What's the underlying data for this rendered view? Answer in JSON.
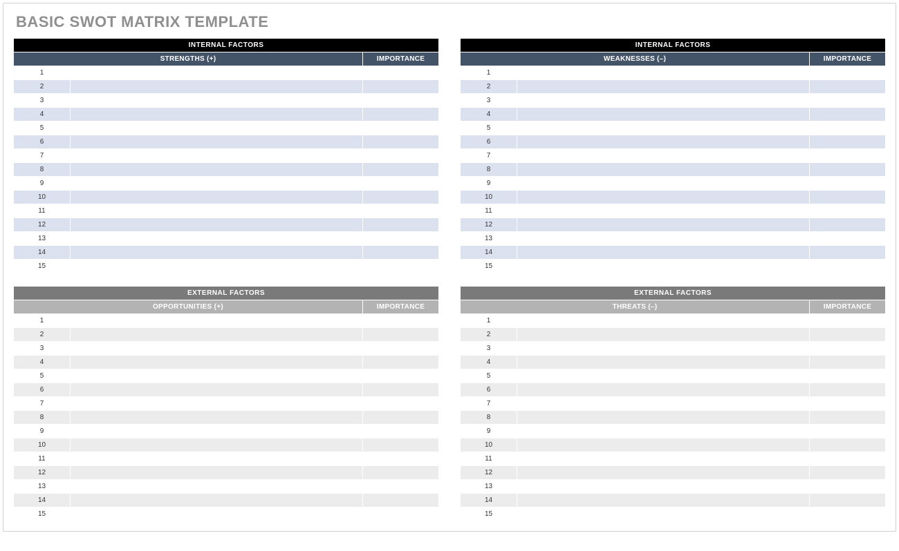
{
  "title": "BASIC SWOT MATRIX TEMPLATE",
  "row_count": 15,
  "importance_label": "IMPORTANCE",
  "quadrants": [
    {
      "id": "strengths",
      "section": "INTERNAL FACTORS",
      "header": "STRENGTHS (+)",
      "theme": "internal"
    },
    {
      "id": "weaknesses",
      "section": "INTERNAL FACTORS",
      "header": "WEAKNESSES (–)",
      "theme": "internal"
    },
    {
      "id": "opportunities",
      "section": "EXTERNAL FACTORS",
      "header": "OPPORTUNITIES (+)",
      "theme": "external"
    },
    {
      "id": "threats",
      "section": "EXTERNAL FACTORS",
      "header": "THREATS (–)",
      "theme": "external"
    }
  ]
}
